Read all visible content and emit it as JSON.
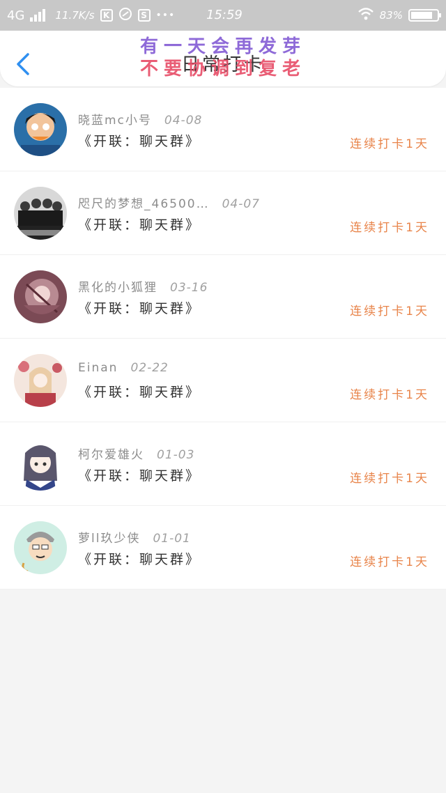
{
  "status_bar": {
    "network": "4G",
    "speed": "11.7K/s",
    "app_icon_1": "K",
    "app_icon_3": "S",
    "more": "•••",
    "time": "15:59",
    "battery": "83%",
    "battery_level": 0.83
  },
  "header": {
    "title": "日常打卡",
    "overlay_line1": "有一天会再发芽",
    "overlay_line2": "不要协调到复老",
    "back_icon": "chevron-left-icon"
  },
  "colors": {
    "accent": "#e8844a",
    "back": "#2f8ff0",
    "overlay_purple": "#8e6ad8",
    "overlay_red": "#e8506a"
  },
  "items": [
    {
      "name": "晓蓝mc小号",
      "date": "04-08",
      "group": "《开联：聊天群》",
      "streak": "连续打卡1天"
    },
    {
      "name": "咫尺的梦想_46500…",
      "date": "04-07",
      "group": "《开联：聊天群》",
      "streak": "连续打卡1天"
    },
    {
      "name": "黑化的小狐狸",
      "date": "03-16",
      "group": "《开联：聊天群》",
      "streak": "连续打卡1天"
    },
    {
      "name": "Einan",
      "date": "02-22",
      "group": "《开联：聊天群》",
      "streak": "连续打卡1天"
    },
    {
      "name": "柯尔爱雄火",
      "date": "01-03",
      "group": "《开联：聊天群》",
      "streak": "连续打卡1天"
    },
    {
      "name": "萝ll玖少侠",
      "date": "01-01",
      "group": "《开联：聊天群》",
      "streak": "连续打卡1天"
    }
  ]
}
